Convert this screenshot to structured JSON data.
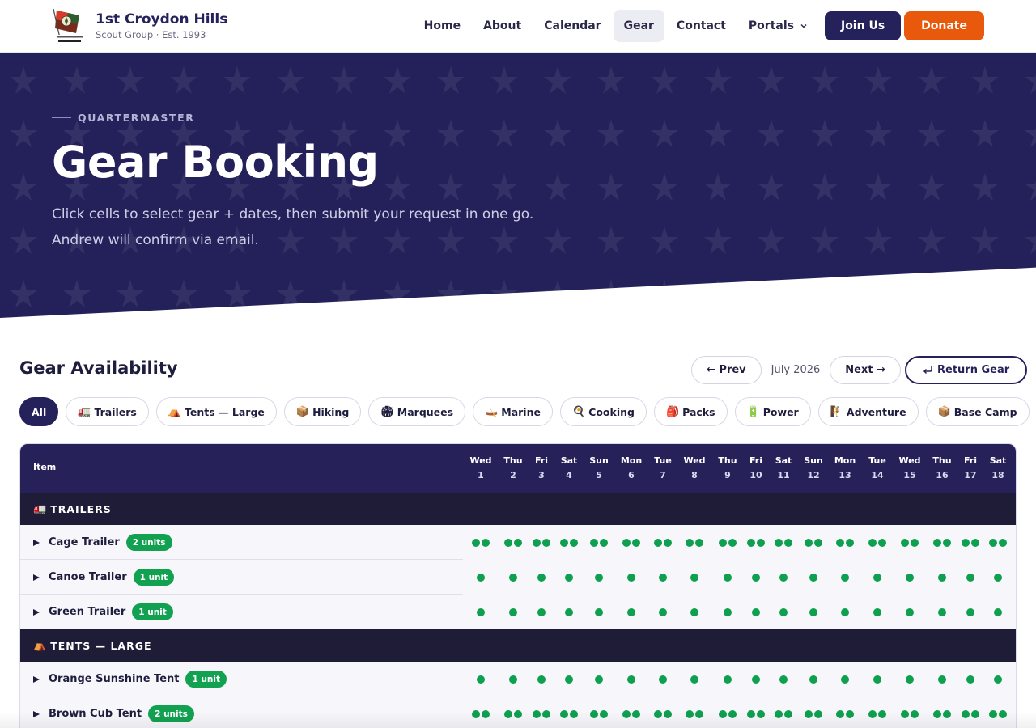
{
  "header": {
    "brand_title": "1st Croydon Hills",
    "brand_sub": "Scout Group · Est. 1993",
    "logo_icon": "scout-emblem-icon",
    "nav": [
      {
        "label": "Home",
        "active": false
      },
      {
        "label": "About",
        "active": false
      },
      {
        "label": "Calendar",
        "active": false
      },
      {
        "label": "Gear",
        "active": true
      },
      {
        "label": "Contact",
        "active": false
      }
    ],
    "portals_label": "Portals",
    "join_label": "Join Us",
    "donate_label": "Donate"
  },
  "hero": {
    "eyebrow": "QUARTERMASTER",
    "title": "Gear Booking",
    "description": "Click cells to select gear + dates, then submit your request in one go. Andrew will confirm via email."
  },
  "availability": {
    "title": "Gear Availability",
    "prev_label": "← Prev",
    "month": "July 2026",
    "next_label": "Next →",
    "return_label": "Return Gear",
    "return_icon": "return-arrow-icon"
  },
  "filters": [
    {
      "label": "All",
      "icon": "",
      "active": true
    },
    {
      "label": "Trailers",
      "icon": "🚛",
      "active": false
    },
    {
      "label": "Tents — Large",
      "icon": "⛺",
      "active": false
    },
    {
      "label": "Hiking",
      "icon": "📦",
      "active": false
    },
    {
      "label": "Marquees",
      "icon": "🏟",
      "active": false
    },
    {
      "label": "Marine",
      "icon": "🛶",
      "active": false
    },
    {
      "label": "Cooking",
      "icon": "🍳",
      "active": false
    },
    {
      "label": "Packs",
      "icon": "🎒",
      "active": false
    },
    {
      "label": "Power",
      "icon": "🔋",
      "active": false
    },
    {
      "label": "Adventure",
      "icon": "🧗",
      "active": false
    },
    {
      "label": "Base Camp",
      "icon": "📦",
      "active": false
    }
  ],
  "table": {
    "item_header": "Item",
    "days": [
      {
        "dow": "Wed",
        "num": "1"
      },
      {
        "dow": "Thu",
        "num": "2"
      },
      {
        "dow": "Fri",
        "num": "3"
      },
      {
        "dow": "Sat",
        "num": "4"
      },
      {
        "dow": "Sun",
        "num": "5"
      },
      {
        "dow": "Mon",
        "num": "6"
      },
      {
        "dow": "Tue",
        "num": "7"
      },
      {
        "dow": "Wed",
        "num": "8"
      },
      {
        "dow": "Thu",
        "num": "9"
      },
      {
        "dow": "Fri",
        "num": "10"
      },
      {
        "dow": "Sat",
        "num": "11"
      },
      {
        "dow": "Sun",
        "num": "12"
      },
      {
        "dow": "Mon",
        "num": "13"
      },
      {
        "dow": "Tue",
        "num": "14"
      },
      {
        "dow": "Wed",
        "num": "15"
      },
      {
        "dow": "Thu",
        "num": "16"
      },
      {
        "dow": "Fri",
        "num": "17"
      },
      {
        "dow": "Sat",
        "num": "18"
      }
    ],
    "categories": [
      {
        "label": "TRAILERS",
        "icon": "🚛",
        "items": [
          {
            "name": "Cage Trailer",
            "badge": "2 units",
            "available": 2
          },
          {
            "name": "Canoe Trailer",
            "badge": "1 unit",
            "available": 1
          },
          {
            "name": "Green Trailer",
            "badge": "1 unit",
            "available": 1
          }
        ]
      },
      {
        "label": "TENTS — LARGE",
        "icon": "⛺",
        "items": [
          {
            "name": "Orange Sunshine Tent",
            "badge": "1 unit",
            "available": 1
          },
          {
            "name": "Brown Cub Tent",
            "badge": "2 units",
            "available": 2
          }
        ]
      }
    ],
    "available_color": "#0e9f4f"
  },
  "colors": {
    "brand_navy": "#25215a",
    "donate_orange": "#e8590c",
    "badge_green": "#12a150"
  }
}
